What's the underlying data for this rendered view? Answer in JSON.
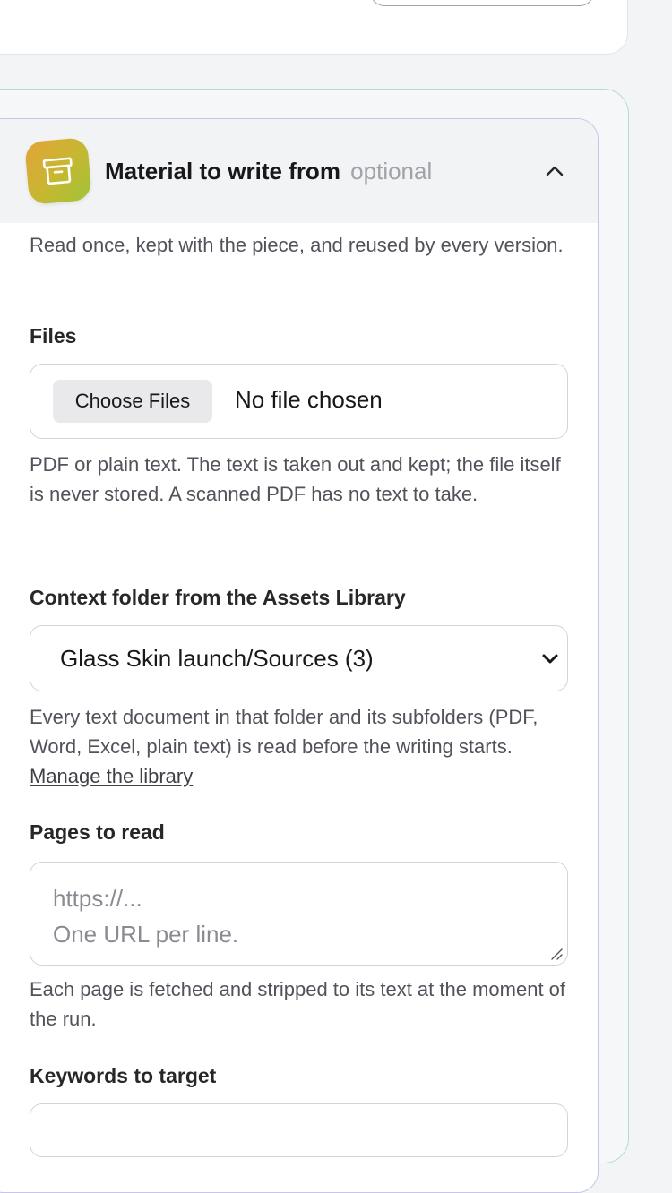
{
  "section": {
    "title": "Material to write from",
    "optional_tag": "optional",
    "description": "Read once, kept with the piece, and reused by every version."
  },
  "files": {
    "label": "Files",
    "button_label": "Choose Files",
    "status": "No file chosen",
    "help": "PDF or plain text. The text is taken out and kept; the file itself is never stored. A scanned PDF has no text to take."
  },
  "context_folder": {
    "label": "Context folder from the Assets Library",
    "selected": "Glass Skin launch/Sources (3)",
    "help": "Every text document in that folder and its subfolders (PDF, Word, Excel, plain text) is read before the writing starts.",
    "link": "Manage the library"
  },
  "pages": {
    "label": "Pages to read",
    "placeholder_line1": "https://...",
    "placeholder_line2": "One URL per line.",
    "help": "Each page is fetched and stripped to its text at the moment of the run."
  },
  "keywords": {
    "label": "Keywords to target"
  },
  "colors": {
    "icon_gradient_start": "#e3a43a",
    "icon_gradient_end": "#9fc438",
    "card_border": "#c8c4ec",
    "panel_border": "#b7d7d9"
  },
  "icons": {
    "header": "archive-box-icon",
    "collapse": "chevron-up-icon",
    "select": "chevron-down-icon"
  }
}
